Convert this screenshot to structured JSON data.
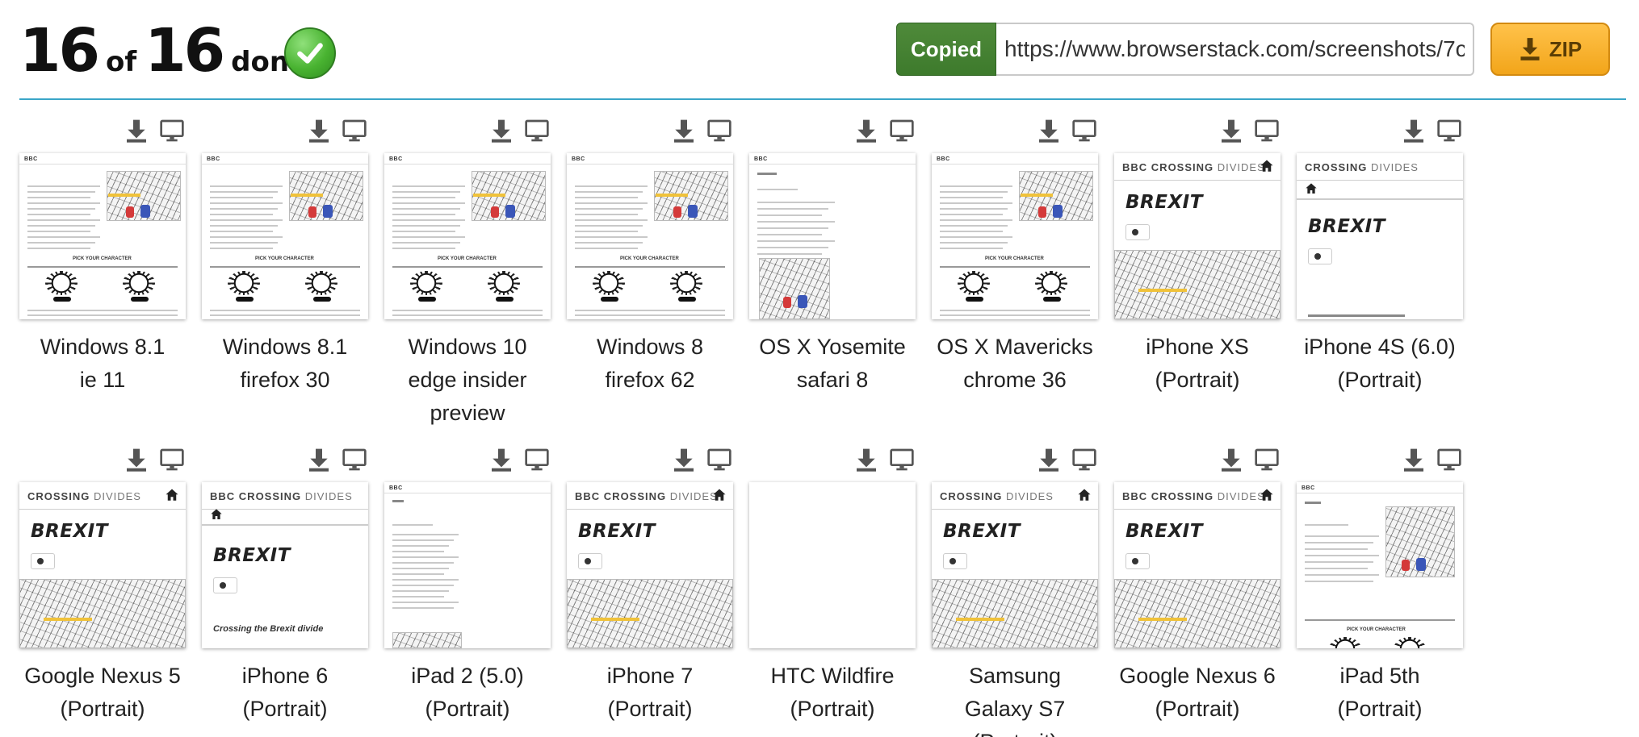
{
  "header": {
    "done_count": "16",
    "of_word": "of",
    "total_count": "16",
    "done_word": "done.",
    "copied_label": "Copied",
    "share_url": "https://www.browserstack.com/screenshots/7c",
    "zip_label": "ZIP"
  },
  "colors": {
    "accent_divider": "#3aa6c8",
    "copied_green": "#4a8636",
    "zip_orange": "#f7b02a",
    "check_green": "#49b331"
  },
  "thumbnail_text": {
    "bbc": "BBC",
    "crossing": "CROSSING",
    "divides": "DIVIDES",
    "brexit": "BREXIT",
    "crossing_divide": "Crossing the Brexit divide",
    "pick_character": "PICK YOUR CHARACTER"
  },
  "icons": {
    "download": "download-icon",
    "monitor": "monitor-icon",
    "home": "home-icon",
    "check": "check-icon"
  },
  "tiles": [
    {
      "line1": "Windows 8.1",
      "line2": "ie 11",
      "line3": ""
    },
    {
      "line1": "Windows 8.1",
      "line2": "firefox 30",
      "line3": ""
    },
    {
      "line1": "Windows 10",
      "line2": "edge insider",
      "line3": "preview"
    },
    {
      "line1": "Windows 8",
      "line2": "firefox 62",
      "line3": ""
    },
    {
      "line1": "OS X Yosemite",
      "line2": "safari 8",
      "line3": ""
    },
    {
      "line1": "OS X Mavericks",
      "line2": "chrome 36",
      "line3": ""
    },
    {
      "line1": "iPhone XS",
      "line2": "(Portrait)",
      "line3": ""
    },
    {
      "line1": "iPhone 4S (6.0)",
      "line2": "(Portrait)",
      "line3": ""
    },
    {
      "line1": "Google Nexus 5",
      "line2": "(Portrait)",
      "line3": ""
    },
    {
      "line1": "iPhone 6",
      "line2": "(Portrait)",
      "line3": ""
    },
    {
      "line1": "iPad 2 (5.0)",
      "line2": "(Portrait)",
      "line3": ""
    },
    {
      "line1": "iPhone 7",
      "line2": "(Portrait)",
      "line3": ""
    },
    {
      "line1": "HTC Wildfire",
      "line2": "(Portrait)",
      "line3": ""
    },
    {
      "line1": "Samsung",
      "line2": "Galaxy S7",
      "line3": "(Portrait)"
    },
    {
      "line1": "Google Nexus 6",
      "line2": "(Portrait)",
      "line3": ""
    },
    {
      "line1": "iPad 5th",
      "line2": "(Portrait)",
      "line3": ""
    }
  ]
}
